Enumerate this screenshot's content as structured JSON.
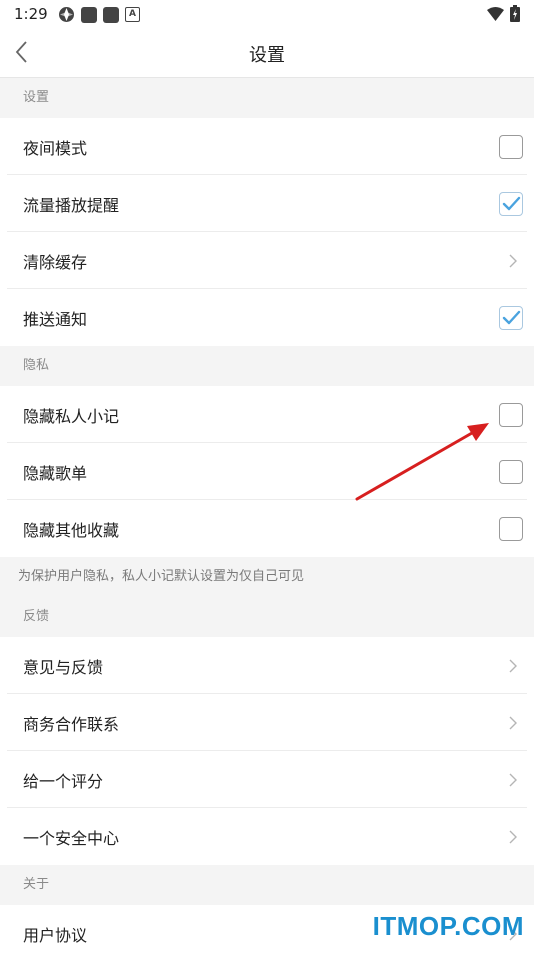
{
  "status_bar": {
    "time": "1:29",
    "left_icons": [
      "aperture-icon",
      "app-icon",
      "app-icon",
      "a-icon"
    ],
    "a_glyph": "A",
    "right_icons": [
      "wifi-icon",
      "battery-icon"
    ]
  },
  "header": {
    "title": "设置"
  },
  "sections": {
    "settings": {
      "label": "设置",
      "rows": [
        {
          "label": "夜间模式",
          "control": "checkbox",
          "checked": false
        },
        {
          "label": "流量播放提醒",
          "control": "checkbox",
          "checked": true
        },
        {
          "label": "清除缓存",
          "control": "chevron"
        },
        {
          "label": "推送通知",
          "control": "checkbox",
          "checked": true
        }
      ]
    },
    "privacy": {
      "label": "隐私",
      "rows": [
        {
          "label": "隐藏私人小记",
          "control": "checkbox",
          "checked": false
        },
        {
          "label": "隐藏歌单",
          "control": "checkbox",
          "checked": false
        },
        {
          "label": "隐藏其他收藏",
          "control": "checkbox",
          "checked": false
        }
      ],
      "note": "为保护用户隐私，私人小记默认设置为仅自己可见"
    },
    "feedback": {
      "label": "反馈",
      "rows": [
        {
          "label": "意见与反馈",
          "control": "chevron"
        },
        {
          "label": "商务合作联系",
          "control": "chevron"
        },
        {
          "label": "给一个评分",
          "control": "chevron"
        },
        {
          "label": "一个安全中心",
          "control": "chevron"
        }
      ]
    },
    "about": {
      "label": "关于",
      "rows": [
        {
          "label": "用户协议",
          "control": "chevron"
        }
      ]
    }
  },
  "annotation": {
    "color": "#d71f1f"
  },
  "watermark": "ITMOP.COM",
  "colors": {
    "check": "#4aa3df",
    "background": "#f4f4f4",
    "watermark": "#1a8fcf"
  }
}
